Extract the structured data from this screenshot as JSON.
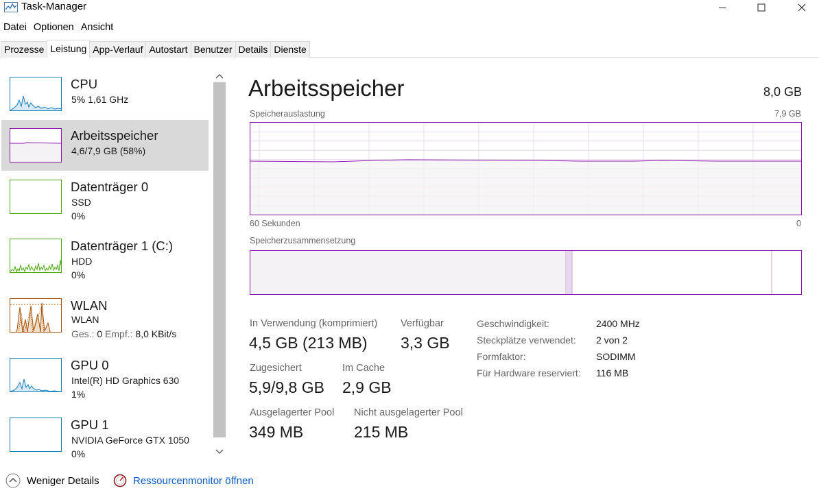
{
  "window": {
    "title": "Task-Manager"
  },
  "menu": [
    "Datei",
    "Optionen",
    "Ansicht"
  ],
  "tabs": [
    "Prozesse",
    "Leistung",
    "App-Verlauf",
    "Autostart",
    "Benutzer",
    "Details",
    "Dienste"
  ],
  "active_tab": "Leistung",
  "sidebar": {
    "items": [
      {
        "name": "CPU",
        "sub1": "5%  1,61 GHz",
        "color": "#117dbb"
      },
      {
        "name": "Arbeitsspeicher",
        "sub1": "4,6/7,9 GB (58%)",
        "color": "#8b12ae"
      },
      {
        "name": "Datenträger 0",
        "sub1": "SSD",
        "sub2": "0%",
        "color": "#4da60c"
      },
      {
        "name": "Datenträger 1 (C:)",
        "sub1": "HDD",
        "sub2": "0%",
        "color": "#4da60c"
      },
      {
        "name": "WLAN",
        "sub1": "WLAN",
        "sub2_send_label": "Ges.:",
        "sub2_send_value": "0",
        "sub2_recv_label": "Empf.:",
        "sub2_recv_value": "8,0 KBit/s",
        "color": "#a74f01"
      },
      {
        "name": "GPU 0",
        "sub1": "Intel(R) HD Graphics 630",
        "sub2": "1%",
        "color": "#117dbb"
      },
      {
        "name": "GPU 1",
        "sub1": "NVIDIA GeForce GTX 1050",
        "sub2": "0%",
        "color": "#117dbb"
      }
    ]
  },
  "main": {
    "title": "Arbeitsspeicher",
    "total": "8,0 GB",
    "graph_label": "Speicherauslastung",
    "graph_max": "7,9 GB",
    "graph_time": "60 Sekunden",
    "graph_zero": "0",
    "composition_label": "Speicherzusammensetzung",
    "memory_usage_fraction": 0.58,
    "stats": {
      "in_use_label": "In Verwendung (komprimiert)",
      "in_use_value": "4,5 GB (213 MB)",
      "available_label": "Verfügbar",
      "available_value": "3,3 GB",
      "committed_label": "Zugesichert",
      "committed_value": "5,9/9,8 GB",
      "cached_label": "Im Cache",
      "cached_value": "2,9 GB",
      "paged_label": "Ausgelagerter Pool",
      "paged_value": "349 MB",
      "nonpaged_label": "Nicht ausgelagerter Pool",
      "nonpaged_value": "215 MB"
    },
    "info": {
      "speed_label": "Geschwindigkeit:",
      "speed_value": "2400 MHz",
      "slots_label": "Steckplätze verwendet:",
      "slots_value": "2 von 2",
      "form_label": "Formfaktor:",
      "form_value": "SODIMM",
      "reserved_label": "Für Hardware reserviert:",
      "reserved_value": "116 MB"
    }
  },
  "footer": {
    "fewer_details": "Weniger Details",
    "resource_monitor": "Ressourcenmonitor öffnen"
  },
  "colors": {
    "memory": "#8b12ae",
    "cpu": "#117dbb",
    "disk": "#4da60c",
    "network": "#a74f01",
    "link": "#0b5bc4"
  }
}
